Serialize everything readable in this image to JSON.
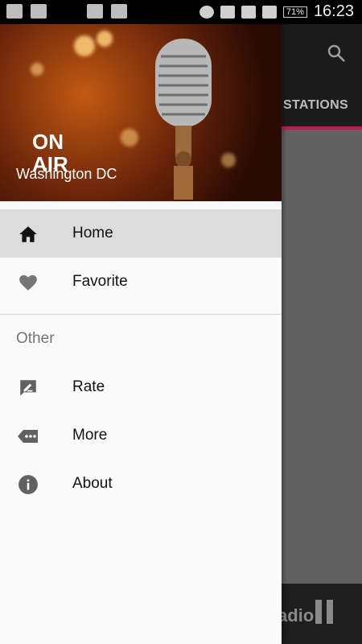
{
  "statusbar": {
    "battery": "71%",
    "time": "16:23"
  },
  "app": {
    "tab_label": "STATIONS",
    "player_text": "adio"
  },
  "drawer": {
    "header": {
      "on_air": "ON AIR",
      "city": "Washington DC"
    },
    "items": [
      {
        "label": "Home",
        "icon": "home-icon",
        "active": true
      },
      {
        "label": "Favorite",
        "icon": "heart-icon",
        "active": false
      }
    ],
    "section_title": "Other",
    "other_items": [
      {
        "label": "Rate",
        "icon": "rate-icon"
      },
      {
        "label": "More",
        "icon": "more-icon"
      },
      {
        "label": "About",
        "icon": "info-icon"
      }
    ]
  },
  "colors": {
    "accent": "#c2185b",
    "active_bg": "#dcdcdc"
  }
}
